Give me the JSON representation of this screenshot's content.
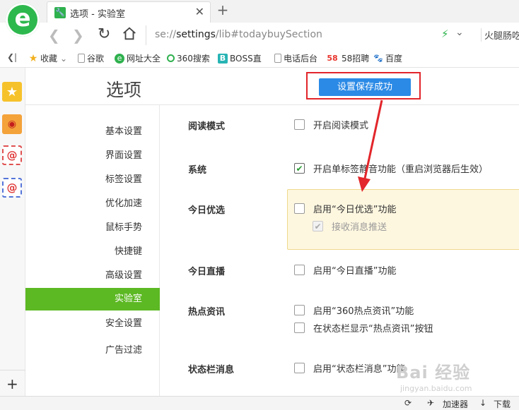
{
  "tab": {
    "title": "选项 - 实验室",
    "close": "✕",
    "new": "+"
  },
  "address": {
    "url_prefix": "se://",
    "url_host": "settings",
    "url_rest": "/lib#todaybuySection",
    "search_hint": "火腿肠吃"
  },
  "bookmarks": [
    {
      "label": "收藏",
      "icon": "star-icon"
    },
    {
      "label": "谷歌",
      "icon": "page-icon"
    },
    {
      "label": "网址大全",
      "icon": "360-nav-icon"
    },
    {
      "label": "360搜索",
      "icon": "360-search-icon"
    },
    {
      "label": "BOSS直",
      "icon": "boss-icon"
    },
    {
      "label": "电话后台",
      "icon": "page-icon"
    },
    {
      "label": "58招聘",
      "icon": "58-icon"
    },
    {
      "label": "百度",
      "icon": "baidu-icon"
    }
  ],
  "page": {
    "title": "选项",
    "toast": "设置保存成功"
  },
  "nav": [
    {
      "label": "基本设置"
    },
    {
      "label": "界面设置"
    },
    {
      "label": "标签设置"
    },
    {
      "label": "优化加速"
    },
    {
      "label": "鼠标手势"
    },
    {
      "label": "快捷键"
    },
    {
      "label": "高级设置"
    },
    {
      "label": "实验室",
      "active": true
    },
    {
      "label": "安全设置"
    },
    {
      "label": "广告过滤"
    }
  ],
  "sections": {
    "reading": {
      "label": "阅读模式",
      "opt1": "开启阅读模式"
    },
    "system": {
      "label": "系统",
      "opt1": "开启单标签静音功能（重启浏览器后生效）"
    },
    "today_pick": {
      "label": "今日优选",
      "opt1": "启用“今日优选”功能",
      "opt2": "接收消息推送"
    },
    "today_live": {
      "label": "今日直播",
      "opt1": "启用“今日直播”功能"
    },
    "hot_news": {
      "label": "热点资讯",
      "opt1": "启用“360热点资讯”功能",
      "opt2": "在状态栏显示“热点资讯”按钮"
    },
    "status_msg": {
      "label": "状态栏消息",
      "opt1": "启用“状态栏消息”功能"
    }
  },
  "watermark": {
    "text": "Bai 经验",
    "sub": "jingyan.baidu.com"
  },
  "statusbar": {
    "accelerator": "加速器",
    "download": "下载"
  },
  "colors": {
    "accent_green": "#5cb823",
    "toast_blue": "#2b8ae6",
    "annotation_red": "#e2262b",
    "panel_bg": "#fef7e0"
  }
}
